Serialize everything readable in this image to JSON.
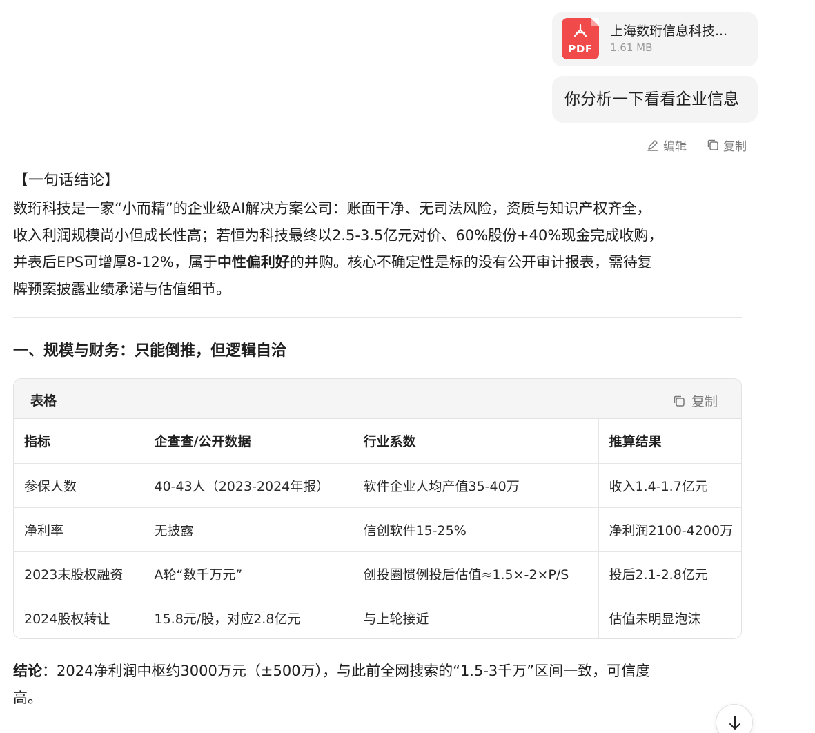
{
  "attachment": {
    "type_label": "PDF",
    "file_name": "上海数珩信息科技...",
    "file_size": "1.61 MB"
  },
  "user_message": {
    "text": "你分析一下看看企业信息",
    "edit_label": "编辑",
    "copy_label": "复制"
  },
  "summary": {
    "title": "【一句话结论】",
    "line1": "数珩科技是一家“小而精”的企业级AI解决方案公司：账面干净、无司法风险，资质与知识产权齐全，",
    "line2": "收入利润规模尚小但成长性高；若恒为科技最终以2.5-3.5亿元对价、60%股份+40%现金完成收购，",
    "line3_pre": "并表后EPS可增厚8-12%，属于",
    "line3_bold": "中性偏利好",
    "line3_post": "的并购。核心不确定性是标的没有公开审计报表，需待复",
    "line4": "牌预案披露业绩承诺与估值细节。"
  },
  "section1": {
    "heading": "一、规模与财务：只能倒推，但逻辑自洽"
  },
  "table": {
    "label": "表格",
    "copy_label": "复制",
    "headers": [
      "指标",
      "企查查/公开数据",
      "行业系数",
      "推算结果"
    ],
    "rows": [
      [
        "参保人数",
        "40-43人（2023-2024年报）",
        "软件企业人均产值35-40万",
        "收入1.4-1.7亿元"
      ],
      [
        "净利率",
        "无披露",
        "信创软件15-25%",
        "净利润2100-4200万"
      ],
      [
        "2023末股权融资",
        "A轮“数千万元”",
        "创投圈惯例投后估值≈1.5×-2×P/S",
        "投后2.1-2.8亿元"
      ],
      [
        "2024股权转让",
        "15.8元/股，对应2.8亿元",
        "与上轮接近",
        "估值未明显泡沫"
      ]
    ]
  },
  "conclusion": {
    "label": "结论",
    "line1": "：2024净利润中枢约3000万元（±500万），与此前全网搜索的“1.5-3千万”区间一致，可信度",
    "line2": "高。"
  },
  "colors": {
    "pdf_red": "#f04a4a",
    "bubble_bg": "#f4f4f5",
    "table_header_bg": "#f5f5f6",
    "muted_text": "#7a7a7a"
  },
  "icons": {
    "pdf": "pdf-icon",
    "edit": "pencil-icon",
    "copy": "copy-icon",
    "scroll": "arrow-down-icon"
  }
}
